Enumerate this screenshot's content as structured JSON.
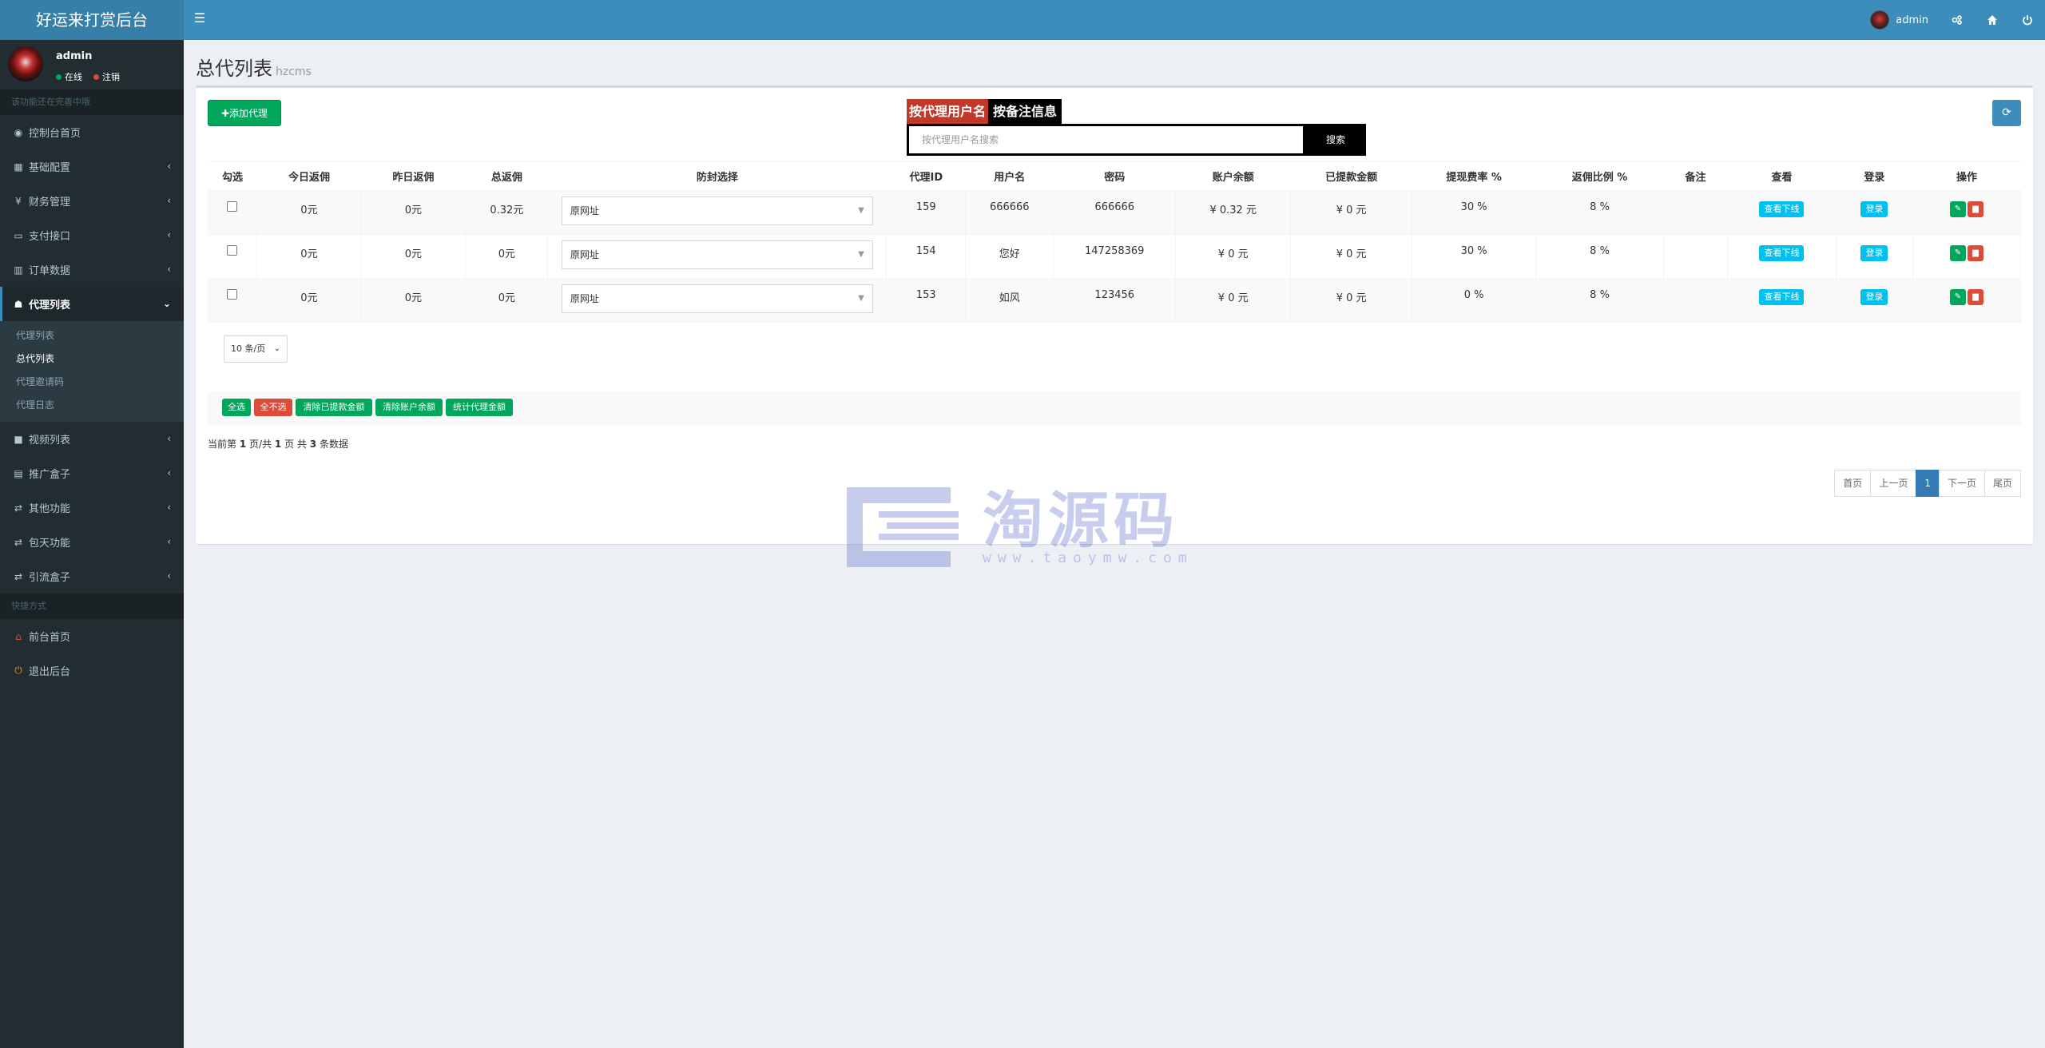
{
  "app": {
    "title": "好运来打赏后台"
  },
  "topbar": {
    "user_name": "admin"
  },
  "sidebar": {
    "user": {
      "name": "admin",
      "online": "在线",
      "logout": "注销"
    },
    "header_main": "该功能还在完善中哦",
    "items": [
      {
        "label": "控制台首页",
        "icon": "dashboard-icon",
        "glyph": "◉"
      },
      {
        "label": "基础配置",
        "icon": "grid-icon",
        "glyph": "▦"
      },
      {
        "label": "财务管理",
        "icon": "yen-icon",
        "glyph": "¥"
      },
      {
        "label": "支付接口",
        "icon": "credit-card-icon",
        "glyph": "▭"
      },
      {
        "label": "订单数据",
        "icon": "bar-chart-icon",
        "glyph": "▥"
      },
      {
        "label": "代理列表",
        "icon": "users-icon",
        "glyph": "☗"
      }
    ],
    "sub_items": [
      {
        "label": "代理列表"
      },
      {
        "label": "总代列表"
      },
      {
        "label": "代理邀请码"
      },
      {
        "label": "代理日志"
      }
    ],
    "items_after": [
      {
        "label": "视频列表",
        "icon": "video-icon",
        "glyph": "■"
      },
      {
        "label": "推广盒子",
        "icon": "table-icon",
        "glyph": "▤"
      },
      {
        "label": "其他功能",
        "icon": "retweet-icon",
        "glyph": "⇄"
      },
      {
        "label": "包天功能",
        "icon": "retweet-icon",
        "glyph": "⇄"
      },
      {
        "label": "引流盒子",
        "icon": "retweet-icon",
        "glyph": "⇄"
      }
    ],
    "header_quick": "快捷方式",
    "quick": [
      {
        "label": "前台首页",
        "icon": "home-icon",
        "glyph": "⌂"
      },
      {
        "label": "退出后台",
        "icon": "power-icon",
        "glyph": "⏻"
      }
    ]
  },
  "page": {
    "title": "总代列表",
    "subtitle": "hzcms"
  },
  "toolbar": {
    "add_label": "✚添加代理"
  },
  "search": {
    "tab_username": "按代理用户名",
    "tab_remark": "按备注信息",
    "placeholder": "按代理用户名搜索",
    "button": "搜索"
  },
  "table": {
    "headers": [
      "勾选",
      "今日返佣",
      "昨日返佣",
      "总返佣",
      "防封选择",
      "代理ID",
      "用户名",
      "密码",
      "账户余额",
      "已提款金额",
      "提现费率 %",
      "返佣比例 %",
      "备注",
      "查看",
      "登录",
      "操作"
    ],
    "rows": [
      {
        "today": "0元",
        "yesterday": "0元",
        "total": "0.32元",
        "domain": "原网址",
        "id": "159",
        "username": "666666",
        "password": "666666",
        "balance": "¥ 0.32 元",
        "withdrawn": "¥ 0 元",
        "fee": "30 %",
        "commission": "8 %",
        "remark": "",
        "view": "查看下线",
        "login": "登录"
      },
      {
        "today": "0元",
        "yesterday": "0元",
        "total": "0元",
        "domain": "原网址",
        "id": "154",
        "username": "您好",
        "password": "147258369",
        "balance": "¥ 0 元",
        "withdrawn": "¥ 0 元",
        "fee": "30 %",
        "commission": "8 %",
        "remark": "",
        "view": "查看下线",
        "login": "登录"
      },
      {
        "today": "0元",
        "yesterday": "0元",
        "total": "0元",
        "domain": "原网址",
        "id": "153",
        "username": "如风",
        "password": "123456",
        "balance": "¥ 0 元",
        "withdrawn": "¥ 0 元",
        "fee": "0 %",
        "commission": "8 %",
        "remark": "",
        "view": "查看下线",
        "login": "登录"
      }
    ]
  },
  "pagesize": {
    "value": "10 条/页"
  },
  "bulk": {
    "select_all": "全选",
    "select_none": "全不选",
    "clear_withdrawn": "清除已提款金额",
    "clear_balance": "清除账户余额",
    "stats": "统计代理金额"
  },
  "summary": {
    "prefix": "当前第",
    "page": "1",
    "mid1": "页/共",
    "pages": "1",
    "mid2": "页 共",
    "count": "3",
    "suffix": "条数据"
  },
  "pagination": {
    "first": "首页",
    "prev": "上一页",
    "current": "1",
    "next": "下一页",
    "last": "尾页"
  },
  "watermark": {
    "text": "淘源码",
    "url": "www.taoymw.com"
  },
  "colors": {
    "primary": "#3c8dbc",
    "success": "#00a65a",
    "danger": "#dd4b39",
    "info": "#00c0ef",
    "sidebar": "#222d32"
  }
}
